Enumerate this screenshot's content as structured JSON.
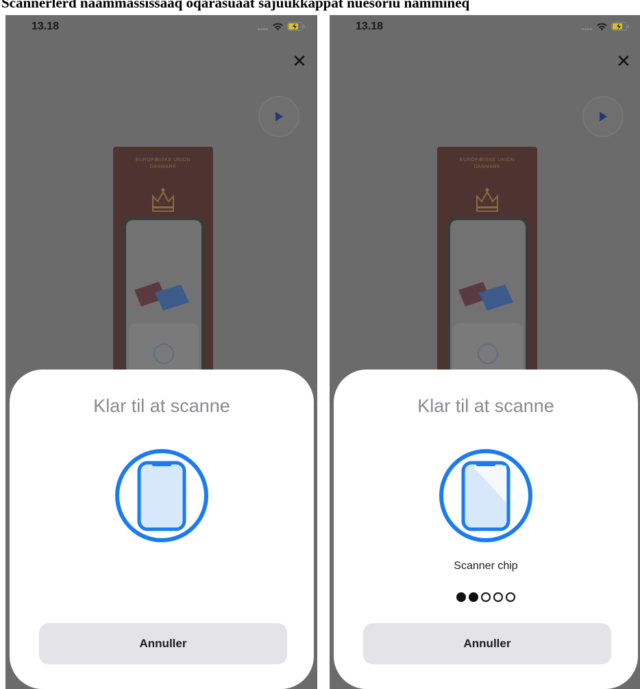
{
  "caption": "Scannerlerd naammassissaaq oqarasuaat sajuukkappat nuesoriu nammineq",
  "phones": [
    {
      "status": {
        "time": "13.18"
      },
      "sheet": {
        "title": "Klar til at scanne",
        "status_text": "",
        "progress_dots": [],
        "cancel_label": "Annuller"
      }
    },
    {
      "status": {
        "time": "13.18"
      },
      "sheet": {
        "title": "Klar til at scanne",
        "status_text": "Scanner chip",
        "progress_dots": [
          true,
          true,
          false,
          false,
          false
        ],
        "cancel_label": "Annuller"
      }
    }
  ],
  "colors": {
    "accent": "#1a7cf0",
    "icon_fill": "#d8e8fb",
    "backdrop": "#6b6b6b",
    "sheet": "#ffffff",
    "button": "#e3e3e8"
  },
  "icons": {
    "close": "close-icon",
    "play": "play-icon",
    "wifi": "wifi-icon",
    "battery": "battery-charging-icon",
    "scan": "phone-scan-icon"
  }
}
